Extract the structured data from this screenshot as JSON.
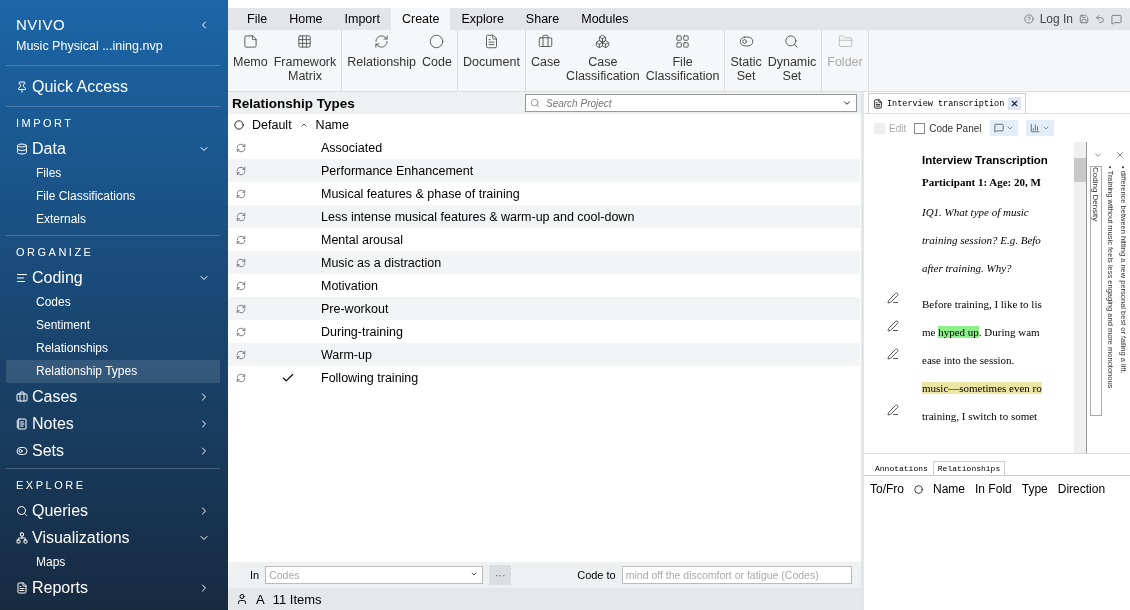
{
  "app": {
    "logo": "NVIVO",
    "project": "Music  Physical ...ining.nvp"
  },
  "sidebar": {
    "quick_access": "Quick Access",
    "sections": [
      {
        "heading": "IMPORT",
        "groups": [
          {
            "label": "Data",
            "expanded": true,
            "children": [
              {
                "label": "Files",
                "selected": false
              },
              {
                "label": "File Classifications",
                "selected": false
              },
              {
                "label": "Externals",
                "selected": false
              }
            ]
          }
        ]
      },
      {
        "heading": "ORGANIZE",
        "groups": [
          {
            "label": "Coding",
            "expanded": true,
            "children": [
              {
                "label": "Codes",
                "selected": false
              },
              {
                "label": "Sentiment",
                "selected": false
              },
              {
                "label": "Relationships",
                "selected": false
              },
              {
                "label": "Relationship Types",
                "selected": true
              }
            ]
          },
          {
            "label": "Cases",
            "expanded": false
          },
          {
            "label": "Notes",
            "expanded": false
          },
          {
            "label": "Sets",
            "expanded": false
          }
        ]
      },
      {
        "heading": "EXPLORE",
        "groups": [
          {
            "label": "Queries",
            "expanded": false
          },
          {
            "label": "Visualizations",
            "expanded": true,
            "children": [
              {
                "label": "Maps",
                "selected": false
              }
            ]
          },
          {
            "label": "Reports",
            "expanded": false
          }
        ]
      }
    ]
  },
  "menu_tabs": [
    {
      "label": "File",
      "selected": false
    },
    {
      "label": "Home",
      "selected": false
    },
    {
      "label": "Import",
      "selected": false
    },
    {
      "label": "Create",
      "selected": true
    },
    {
      "label": "Explore",
      "selected": false
    },
    {
      "label": "Share",
      "selected": false
    },
    {
      "label": "Modules",
      "selected": false
    }
  ],
  "title_bar": {
    "login": "Log In"
  },
  "ribbon": [
    [
      {
        "label": "Memo",
        "disabled": false
      },
      {
        "label": "Framework Matrix",
        "disabled": false
      }
    ],
    [
      {
        "label": "Relationship",
        "disabled": false
      },
      {
        "label": "Code",
        "disabled": false
      }
    ],
    [
      {
        "label": "Document",
        "disabled": false
      }
    ],
    [
      {
        "label": "Case",
        "disabled": false
      },
      {
        "label": "Case Classification",
        "disabled": false
      },
      {
        "label": "File Classification",
        "disabled": false
      }
    ],
    [
      {
        "label": "Static Set",
        "disabled": false
      },
      {
        "label": "Dynamic Set",
        "disabled": false
      }
    ],
    [
      {
        "label": "Folder",
        "disabled": true
      }
    ]
  ],
  "list": {
    "title": "Relationship Types",
    "search_placeholder": "Search Project",
    "columns": [
      "Default",
      "Name"
    ],
    "rows": [
      {
        "name": "Associated",
        "default": false
      },
      {
        "name": "Performance Enhancement",
        "default": false
      },
      {
        "name": "Musical features & phase of training",
        "default": false
      },
      {
        "name": "Less intense musical features & warm-up and cool-down",
        "default": false
      },
      {
        "name": "Mental arousal",
        "default": false
      },
      {
        "name": "Music as a distraction",
        "default": false
      },
      {
        "name": "Motivation",
        "default": false
      },
      {
        "name": "Pre-workout",
        "default": false
      },
      {
        "name": "During-training",
        "default": false
      },
      {
        "name": "Warm-up",
        "default": false
      },
      {
        "name": "Following training",
        "default": true
      }
    ]
  },
  "document": {
    "tab": "Interview transcription",
    "edit": {
      "label": "Edit",
      "disabled": true
    },
    "code_panel": {
      "label": "Code Panel",
      "checked": false
    },
    "heading": "Interview Transcription",
    "participant": "Participant 1: Age: 20, M",
    "question": [
      "IQ1. What type of music",
      "training session? E.g. Befo",
      "after training. Why?"
    ],
    "lines": [
      {
        "coded": true,
        "segments": [
          {
            "text": "Before training, I like to lis",
            "highlighted": false
          }
        ]
      },
      {
        "coded": true,
        "segments": [
          {
            "text": "me ",
            "highlighted": false
          },
          {
            "text": "hyped up",
            "highlighted": true,
            "color": "#8df08d"
          },
          {
            "text": ". During wam",
            "highlighted": false
          }
        ]
      },
      {
        "coded": true,
        "segments": [
          {
            "text": "ease  into  the  session.",
            "highlighted": false
          }
        ]
      },
      {
        "coded": false,
        "segments": [
          {
            "text": "music—sometimes even ro",
            "highlighted": true,
            "color": "#ece6a4"
          }
        ]
      },
      {
        "coded": true,
        "segments": [
          {
            "text": "training, I switch to somet",
            "highlighted": false
          }
        ]
      }
    ],
    "density_label": "Coding Density",
    "stripes": [
      "• Training without music feels less engaging and more monotonous",
      "• difference between hitting a new personal best or failing a lift."
    ]
  },
  "detail_tabs": [
    {
      "label": "Annotations",
      "selected": false
    },
    {
      "label": "Relationships",
      "selected": true
    }
  ],
  "detail_columns": [
    "To/Fro",
    "Name",
    "In Fold",
    "Type",
    "Direction"
  ],
  "code_bar": {
    "in_label": "In",
    "in_placeholder": "Codes",
    "browse": "···",
    "code_to_label": "Code to",
    "code_to_placeholder": "mind off the discomfort or fatigue (Codes)"
  },
  "status": {
    "count": "11 Items",
    "font_label": "A"
  }
}
